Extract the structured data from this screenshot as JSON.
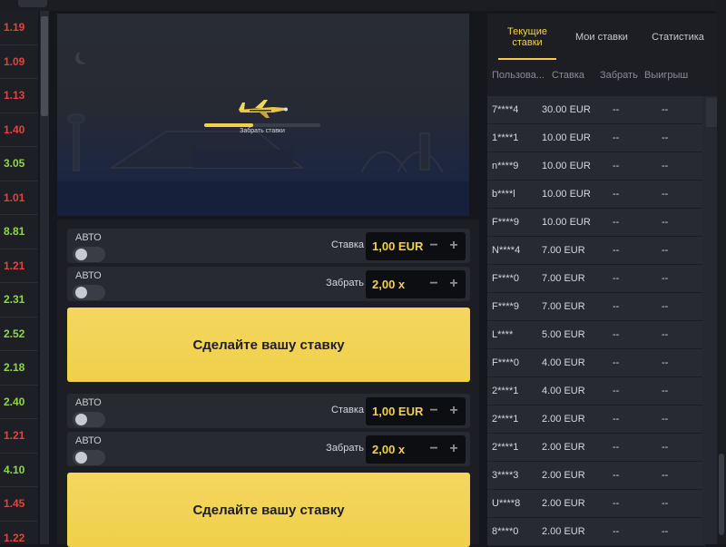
{
  "history": {
    "items": [
      {
        "value": "1.19",
        "color": "#e0443c"
      },
      {
        "value": "1.09",
        "color": "#e0443c"
      },
      {
        "value": "1.13",
        "color": "#e0443c"
      },
      {
        "value": "1.40",
        "color": "#e0443c"
      },
      {
        "value": "3.05",
        "color": "#8fd64a"
      },
      {
        "value": "1.01",
        "color": "#e0443c"
      },
      {
        "value": "8.81",
        "color": "#8fd64a"
      },
      {
        "value": "1.21",
        "color": "#e0443c"
      },
      {
        "value": "2.31",
        "color": "#8fd64a"
      },
      {
        "value": "2.52",
        "color": "#8fd64a"
      },
      {
        "value": "2.18",
        "color": "#8fd64a"
      },
      {
        "value": "2.40",
        "color": "#8fd64a"
      },
      {
        "value": "1.21",
        "color": "#e0443c"
      },
      {
        "value": "4.10",
        "color": "#8fd64a"
      },
      {
        "value": "1.45",
        "color": "#e0443c"
      },
      {
        "value": "1.22",
        "color": "#e0443c"
      }
    ]
  },
  "game": {
    "progress_label": "Забрать ставки",
    "progress_fraction": 0.42,
    "accent": "#f2d14a"
  },
  "bet_panels": [
    {
      "auto_label_1": "АВТО",
      "stake_label": "Ставка",
      "stake_value": "1,00 EUR",
      "auto_label_2": "АВТО",
      "cashout_label": "Забрать",
      "cashout_value": "2,00 x",
      "button_label": "Сделайте вашу ставку"
    },
    {
      "auto_label_1": "АВТО",
      "stake_label": "Ставка",
      "stake_value": "1,00 EUR",
      "auto_label_2": "АВТО",
      "cashout_label": "Забрать",
      "cashout_value": "2,00 x",
      "button_label": "Сделайте вашу ставку"
    }
  ],
  "panel": {
    "tabs": [
      {
        "label": "Текущие ставки",
        "active": true
      },
      {
        "label": "Мои ставки",
        "active": false
      },
      {
        "label": "Статистика",
        "active": false
      }
    ],
    "columns": {
      "user": "Пользова...",
      "bet": "Ставка",
      "cashout": "Забрать",
      "win": "Выигрыш"
    },
    "rows": [
      {
        "user": "7****4",
        "bet": "30.00  EUR",
        "cashout": "--",
        "win": "--"
      },
      {
        "user": "1****1",
        "bet": "10.00  EUR",
        "cashout": "--",
        "win": "--"
      },
      {
        "user": "n****9",
        "bet": "10.00  EUR",
        "cashout": "--",
        "win": "--"
      },
      {
        "user": "b****l",
        "bet": "10.00  EUR",
        "cashout": "--",
        "win": "--"
      },
      {
        "user": "F****9",
        "bet": "10.00  EUR",
        "cashout": "--",
        "win": "--"
      },
      {
        "user": "N****4",
        "bet": "7.00  EUR",
        "cashout": "--",
        "win": "--"
      },
      {
        "user": "F****0",
        "bet": "7.00  EUR",
        "cashout": "--",
        "win": "--"
      },
      {
        "user": "F****9",
        "bet": "7.00  EUR",
        "cashout": "--",
        "win": "--"
      },
      {
        "user": "L****",
        "bet": "5.00  EUR",
        "cashout": "--",
        "win": "--"
      },
      {
        "user": "F****0",
        "bet": "4.00  EUR",
        "cashout": "--",
        "win": "--"
      },
      {
        "user": "2****1",
        "bet": "4.00  EUR",
        "cashout": "--",
        "win": "--"
      },
      {
        "user": "2****1",
        "bet": "2.00  EUR",
        "cashout": "--",
        "win": "--"
      },
      {
        "user": "2****1",
        "bet": "2.00  EUR",
        "cashout": "--",
        "win": "--"
      },
      {
        "user": "3****3",
        "bet": "2.00  EUR",
        "cashout": "--",
        "win": "--"
      },
      {
        "user": "U****8",
        "bet": "2.00  EUR",
        "cashout": "--",
        "win": "--"
      },
      {
        "user": "8****0",
        "bet": "2.00  EUR",
        "cashout": "--",
        "win": "--"
      }
    ]
  }
}
